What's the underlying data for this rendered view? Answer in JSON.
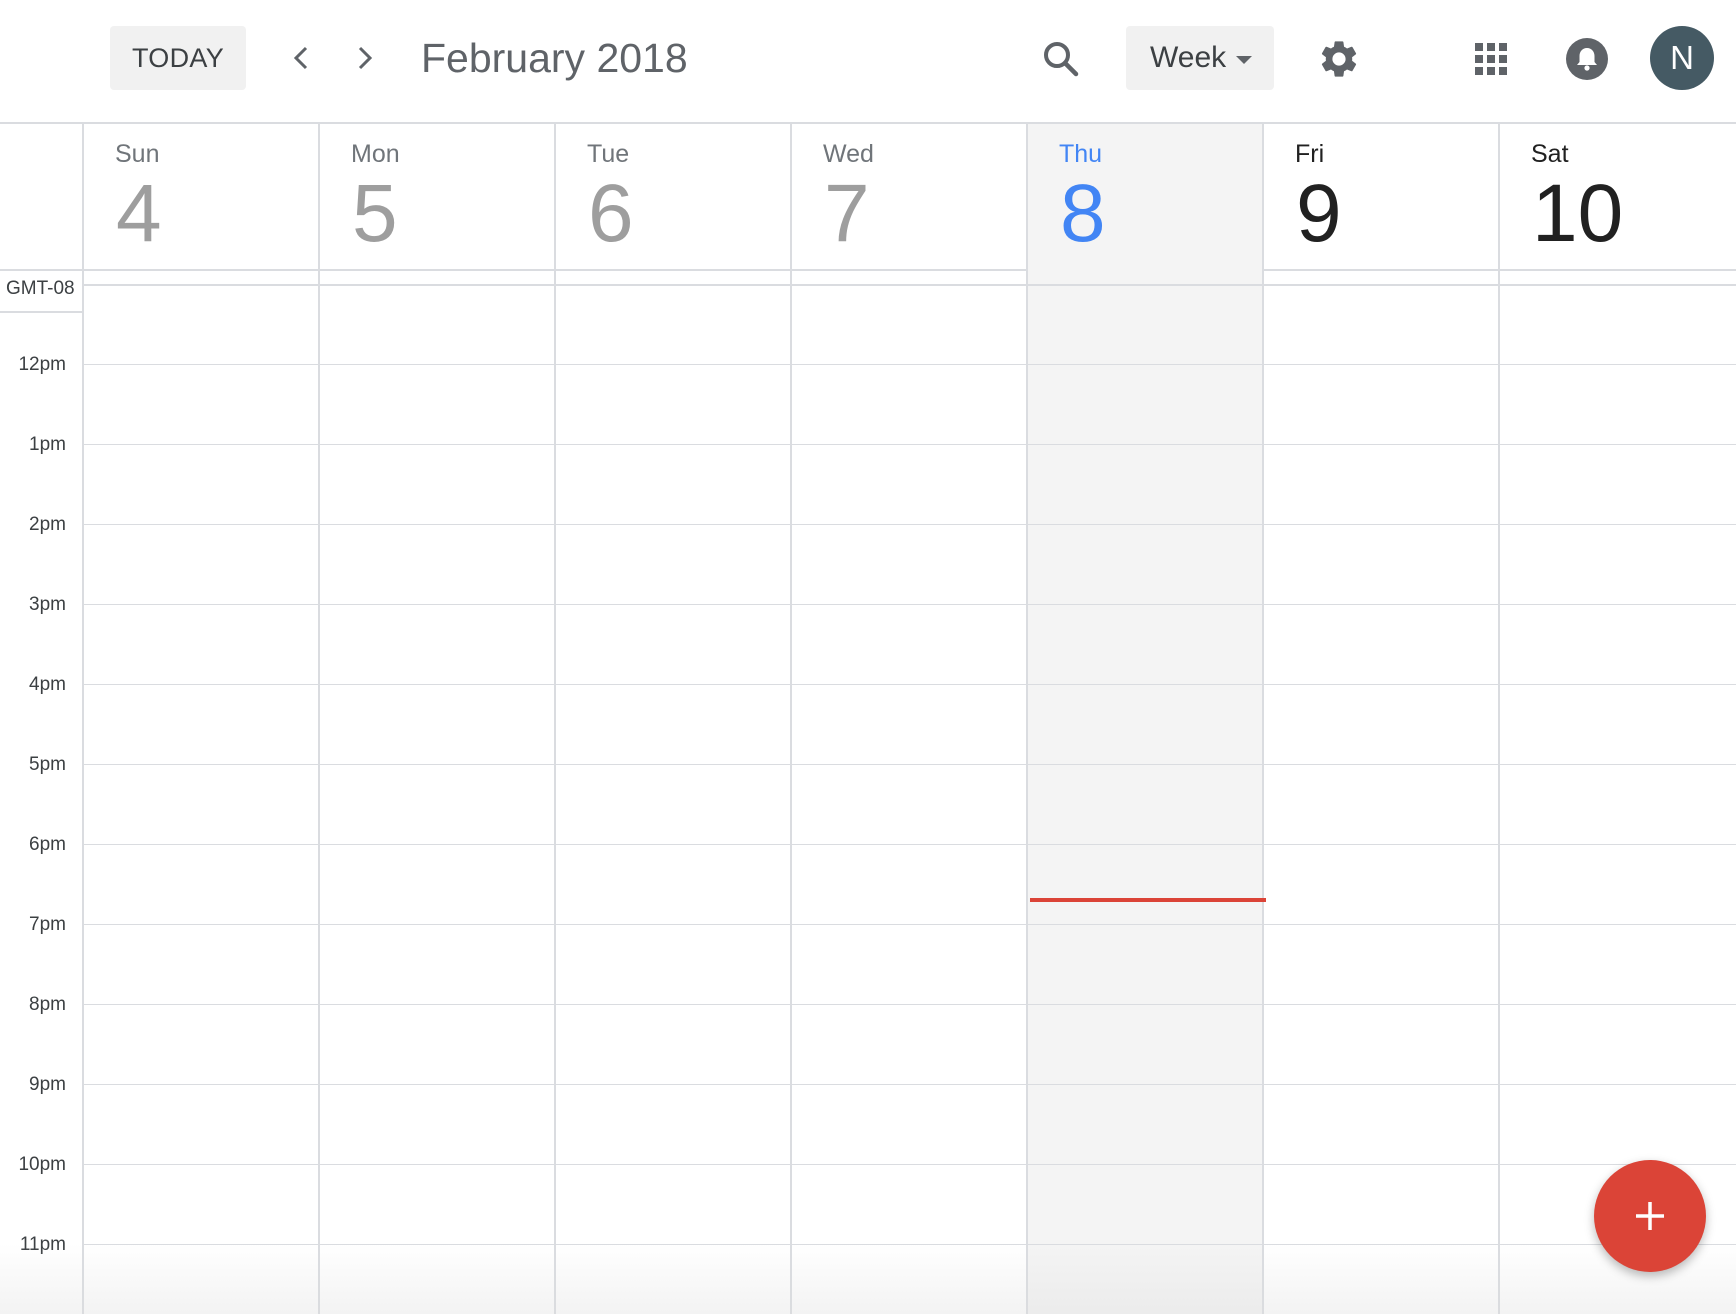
{
  "toolbar": {
    "today_label": "TODAY",
    "month_title": "February 2018",
    "view_select": "Week",
    "avatar_initial": "N"
  },
  "days": [
    {
      "name": "Sun",
      "number": "4",
      "state": "past"
    },
    {
      "name": "Mon",
      "number": "5",
      "state": "past"
    },
    {
      "name": "Tue",
      "number": "6",
      "state": "past"
    },
    {
      "name": "Wed",
      "number": "7",
      "state": "past"
    },
    {
      "name": "Thu",
      "number": "8",
      "state": "today"
    },
    {
      "name": "Fri",
      "number": "9",
      "state": "future"
    },
    {
      "name": "Sat",
      "number": "10",
      "state": "future"
    }
  ],
  "grid": {
    "timezone": "GMT-08",
    "hours": [
      "12pm",
      "1pm",
      "2pm",
      "3pm",
      "4pm",
      "5pm",
      "6pm",
      "7pm",
      "8pm",
      "9pm",
      "10pm",
      "11pm"
    ]
  },
  "colors": {
    "accent": "#4285f4",
    "now_line": "#db4437",
    "fab": "#db4437",
    "avatar": "#455a64"
  },
  "icons": [
    "chevron-left-icon",
    "chevron-right-icon",
    "search-icon",
    "gear-icon",
    "apps-grid-icon",
    "bell-icon",
    "plus-icon"
  ]
}
